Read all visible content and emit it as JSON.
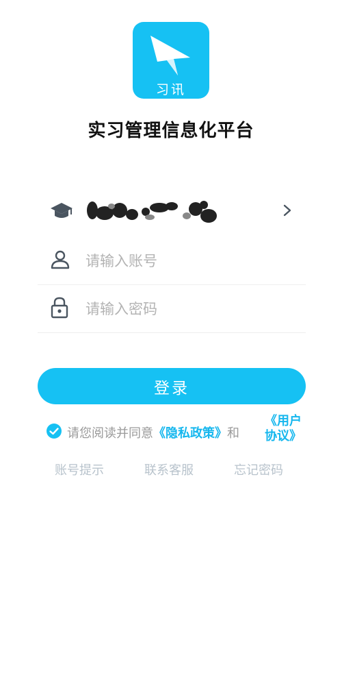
{
  "app": {
    "logo_text": "习讯",
    "title": "实习管理信息化平台"
  },
  "school_row": {
    "icon": "graduation-cap-icon",
    "chevron": "chevron-right-icon"
  },
  "account": {
    "placeholder": "请输入账号",
    "icon": "person-icon"
  },
  "password": {
    "placeholder": "请输入密码",
    "icon": "lock-icon"
  },
  "login_button": "登录",
  "agreement": {
    "prefix": "请您阅读并同意",
    "privacy_link": "《隐私政策》",
    "and": "和",
    "terms_line1": "《用户",
    "terms_line2": "协议》"
  },
  "footer": {
    "account_hint": "账号提示",
    "contact_support": "联系客服",
    "forgot_password": "忘记密码"
  },
  "colors": {
    "accent": "#16c1f3",
    "placeholder": "#b3b3b3",
    "footer_text": "#b8c3cc"
  }
}
